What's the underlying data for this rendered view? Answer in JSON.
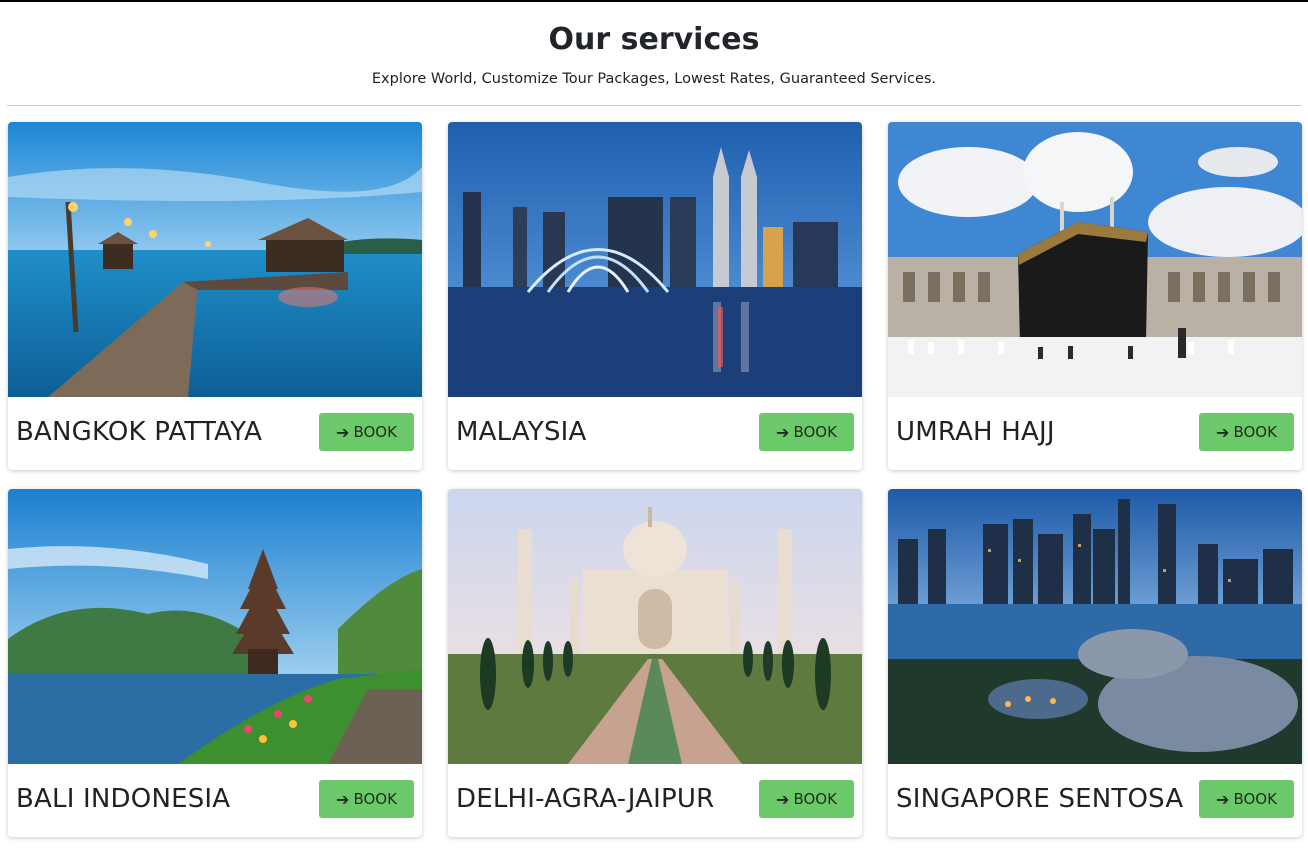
{
  "header": {
    "title": "Our services",
    "subtitle": "Explore World, Customize Tour Packages, Lowest Rates, Guaranteed Services."
  },
  "cards": [
    {
      "title": "BANGKOK PATTAYA",
      "button_label": "BOOK",
      "button_icon": "arrow-right-icon",
      "image": "pier-at-dusk"
    },
    {
      "title": "MALAYSIA",
      "button_label": "BOOK",
      "button_icon": "arrow-right-icon",
      "image": "city-skyline-fountain"
    },
    {
      "title": "UMRAH HAJJ",
      "button_label": "BOOK",
      "button_icon": "arrow-right-icon",
      "image": "kaaba"
    },
    {
      "title": "BALI INDONESIA",
      "button_label": "BOOK",
      "button_icon": "arrow-right-icon",
      "image": "lake-temple"
    },
    {
      "title": "DELHI-AGRA-JAIPUR",
      "button_label": "BOOK",
      "button_icon": "arrow-right-icon",
      "image": "taj-mahal"
    },
    {
      "title": "SINGAPORE SENTOSA",
      "button_label": "BOOK",
      "button_icon": "arrow-right-icon",
      "image": "night-skyline"
    }
  ],
  "colors": {
    "button_bg": "#6cc96a",
    "divider": "#cfcfcf"
  }
}
